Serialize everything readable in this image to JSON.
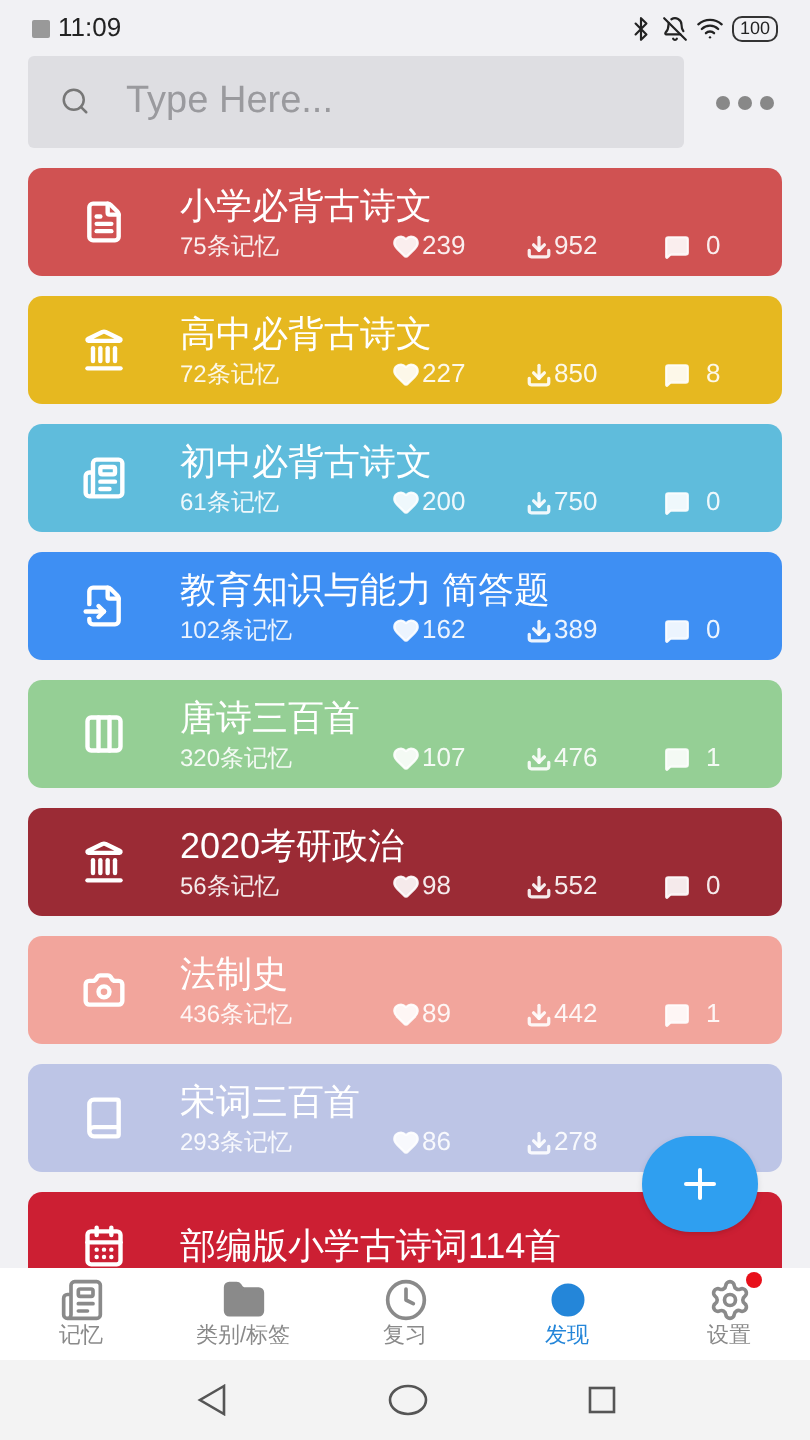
{
  "status_bar": {
    "time": "11:09",
    "battery": "100"
  },
  "search": {
    "placeholder": "Type Here..."
  },
  "decks": [
    {
      "title": "小学必背古诗文",
      "count": "75条记忆",
      "likes": "239",
      "downloads": "952",
      "comments": "0",
      "color": "#d05252"
    },
    {
      "title": "高中必背古诗文",
      "count": "72条记忆",
      "likes": "227",
      "downloads": "850",
      "comments": "8",
      "color": "#e6b820"
    },
    {
      "title": "初中必背古诗文",
      "count": "61条记忆",
      "likes": "200",
      "downloads": "750",
      "comments": "0",
      "color": "#5fbcdc"
    },
    {
      "title": "教育知识与能力 简答题",
      "count": "102条记忆",
      "likes": "162",
      "downloads": "389",
      "comments": "0",
      "color": "#3e8ff3"
    },
    {
      "title": "唐诗三百首",
      "count": "320条记忆",
      "likes": "107",
      "downloads": "476",
      "comments": "1",
      "color": "#95cf95"
    },
    {
      "title": "2020考研政治",
      "count": "56条记忆",
      "likes": "98",
      "downloads": "552",
      "comments": "0",
      "color": "#9b2b35"
    },
    {
      "title": "法制史",
      "count": "436条记忆",
      "likes": "89",
      "downloads": "442",
      "comments": "1",
      "color": "#f2a59c"
    },
    {
      "title": "宋词三百首",
      "count": "293条记忆",
      "likes": "86",
      "downloads": "278",
      "color": "#bdc5e6"
    },
    {
      "title": "部编版小学古诗词114首",
      "color": "#cc1f33"
    }
  ],
  "bottom_nav": [
    {
      "label": "记忆",
      "selected": false,
      "badge": false
    },
    {
      "label": "类别/标签",
      "selected": false,
      "badge": false
    },
    {
      "label": "复习",
      "selected": false,
      "badge": false
    },
    {
      "label": "发现",
      "selected": true,
      "badge": false
    },
    {
      "label": "设置",
      "selected": false,
      "badge": true
    }
  ]
}
